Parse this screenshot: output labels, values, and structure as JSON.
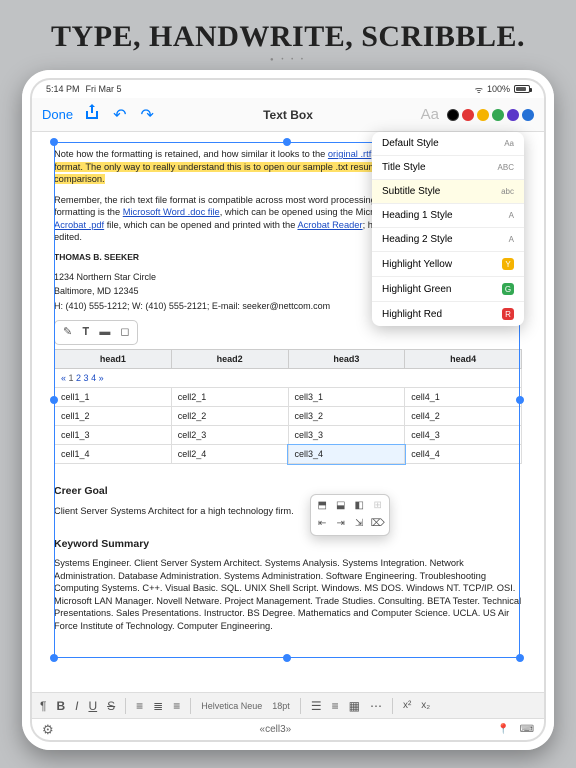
{
  "hero": "TYPE, HANDWRITE, SCRIBBLE.",
  "status": {
    "time": "5:14 PM",
    "date": "Fri Mar 5",
    "battery": "100%"
  },
  "nav": {
    "done": "Done",
    "title": "Text Box"
  },
  "colors": [
    "#000000",
    "#e23636",
    "#f5b301",
    "#34a853",
    "#5b36c9",
    "#2571d6"
  ],
  "styles_menu": [
    {
      "label": "Default Style",
      "hint": "Aa"
    },
    {
      "label": "Title Style",
      "hint": "ABC"
    },
    {
      "label": "Subtitle Style",
      "hint": "abc",
      "active": true
    },
    {
      "label": "Heading 1 Style",
      "hint": "A"
    },
    {
      "label": "Heading 2 Style",
      "hint": "A"
    },
    {
      "label": "Highlight Yellow",
      "swatch": "#f5b301",
      "key": "Y"
    },
    {
      "label": "Highlight Green",
      "swatch": "#34a853",
      "key": "G"
    },
    {
      "label": "Highlight Red",
      "swatch": "#e23636",
      "key": "R"
    }
  ],
  "doc": {
    "p1a": "Note how the formatting is retained, and how similar it looks to the ",
    "p1b": " file. The difference ",
    "p1_hl": "lies in the file format. The only way to really understand this is to open our sample .txt resume to your word processor for a comparison.",
    "p2a": "Remember, the rich text file format is compatible across most word processing formats that retain document formatting is the ",
    "link1": "Microsoft Word .doc file",
    "p2b": ", which can be opened using the Microsoft Word program, and the ",
    "link2": "Adobe Acrobat .pdf",
    "p2c": " file, which can be opened and printed with the ",
    "link3": "Acrobat Reader",
    "p2d": "; however, the document cannot be edited.",
    "author": "THOMAS B. SEEKER",
    "addr1": "1234 Northern Star Circle",
    "addr2": "Baltimore, MD 12345",
    "contact": "H: (410) 555-1212; W: (410) 555-2121; E-mail: seeker@nettcom.com",
    "h_goal": "Creer Goal",
    "goal_text": "Client Server Systems Architect for a high technology firm.",
    "h_kw": "Keyword Summary",
    "kw_text": "Systems Engineer. Client Server System Architect. Systems Analysis. Systems Integration. Network Administration. Database Administration. Systems Administration. Software Engineering. Troubleshooting Computing Systems. C++. Visual Basic. SQL. UNIX Shell Script. Windows. MS DOS. Windows NT. TCP/IP. OSI. Microsoft LAN Manager. Novell Netware. Project Management. Trade Studies. Consulting. BETA Tester. Technical Presentations. Sales Presentations. Instructor. BS Degree. Mathematics and Computer Science. UCLA. US Air Force Institute of Technology. Computer Engineering."
  },
  "table": {
    "headers": [
      "head1",
      "head2",
      "head3",
      "head4"
    ],
    "pager_pre": "« ",
    "pager_pages": [
      "1",
      "2",
      "3",
      "4"
    ],
    "pager_post": " »",
    "rows": [
      [
        "cell1_1",
        "cell2_1",
        "cell3_1",
        "cell4_1"
      ],
      [
        "cell1_2",
        "cell2_2",
        "cell3_2",
        "cell4_2"
      ],
      [
        "cell1_3",
        "cell2_3",
        "cell3_3",
        "cell4_3"
      ],
      [
        "cell1_4",
        "cell2_4",
        "cell3_4",
        "cell4_4"
      ]
    ],
    "editing_value": "cell3_4"
  },
  "toolbar": {
    "font": "Helvetica Neue",
    "size": "18pt"
  },
  "footer": {
    "crumb": "«cell3»"
  }
}
